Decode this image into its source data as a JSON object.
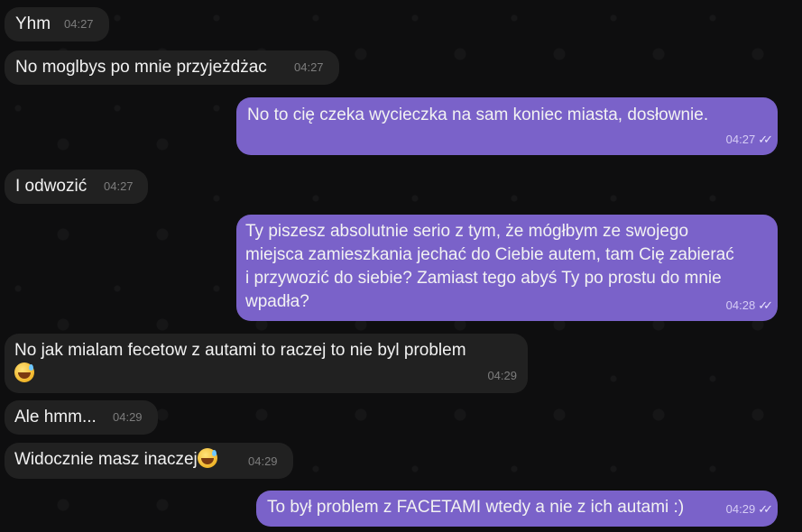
{
  "messages": [
    {
      "id": "m1",
      "direction": "in",
      "text": "Yhm",
      "time": "04:27"
    },
    {
      "id": "m2",
      "direction": "in",
      "text": "No moglbys po mnie przyjeżdżac",
      "time": "04:27"
    },
    {
      "id": "m3",
      "direction": "out",
      "text": "No to cię czeka wycieczka na sam koniec miasta, dosłownie.",
      "time": "04:27",
      "status": "read"
    },
    {
      "id": "m4",
      "direction": "in",
      "text": "I odwozić",
      "time": "04:27"
    },
    {
      "id": "m5",
      "direction": "out",
      "lines": [
        "Ty piszesz absolutnie serio z tym, że mógłbym ze swojego",
        "miejsca zamieszkania jechać do Ciebie autem, tam Cię zabierać",
        "i przywozić do siebie? Zamiast tego abyś Ty po prostu do mnie",
        "wpadła?"
      ],
      "time": "04:28",
      "status": "read"
    },
    {
      "id": "m6",
      "direction": "in",
      "text": "No jak mialam fecetow z autami to raczej to nie byl problem",
      "emoji": "sweat-smile-emoji",
      "time": "04:29"
    },
    {
      "id": "m7",
      "direction": "in",
      "text": "Ale hmm...",
      "time": "04:29"
    },
    {
      "id": "m8",
      "direction": "in",
      "text": "Widocznie  masz inaczej",
      "emoji": "sweat-smile-emoji",
      "time": "04:29"
    },
    {
      "id": "m9",
      "direction": "out",
      "text": "To był problem z FACETAMI wtedy a nie z ich autami :)",
      "time": "04:29",
      "status": "read"
    }
  ],
  "ticks_glyph": "✓✓",
  "colors": {
    "incoming_bubble": "#212121",
    "outgoing_bubble": "#7a62c9",
    "background": "#0e0e0f"
  }
}
